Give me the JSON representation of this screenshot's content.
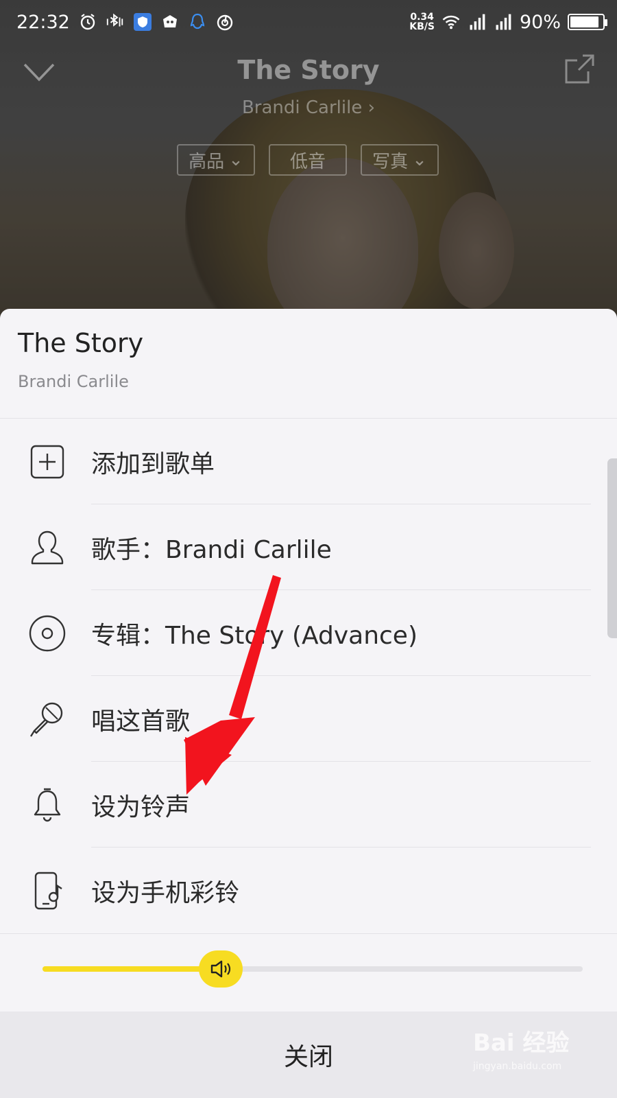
{
  "status_bar": {
    "time": "22:32",
    "net_speed_value": "0.34",
    "net_speed_unit": "KB/S",
    "battery": "90%",
    "battery_level": 0.9
  },
  "player": {
    "title": "The Story",
    "artist": "Brandi Carlile",
    "artist_chevron": "›",
    "quality_buttons": [
      {
        "label": "高品",
        "chevron": "⌄"
      },
      {
        "label": "低音"
      },
      {
        "label": "写真",
        "chevron": "⌄"
      }
    ]
  },
  "sheet": {
    "title": "The Story",
    "subtitle": "Brandi Carlile",
    "menu": [
      {
        "label": "添加到歌单",
        "icon": "add-box-icon"
      },
      {
        "label": "歌手：Brandi Carlile",
        "icon": "singer-icon"
      },
      {
        "label": "专辑：The Story (Advance)",
        "icon": "album-disc-icon"
      },
      {
        "label": "唱这首歌",
        "icon": "microphone-icon"
      },
      {
        "label": "设为铃声",
        "icon": "bell-icon"
      },
      {
        "label": "设为手机彩铃",
        "icon": "phone-music-icon"
      }
    ],
    "volume_level": 0.33,
    "close_label": "关闭"
  },
  "watermark": {
    "text": "Bai 经验",
    "url": "jingyan.baidu.com"
  },
  "colors": {
    "accent": "#f7dc22",
    "annotation_arrow": "#f2141e",
    "sheet_bg": "#f5f4f7"
  }
}
